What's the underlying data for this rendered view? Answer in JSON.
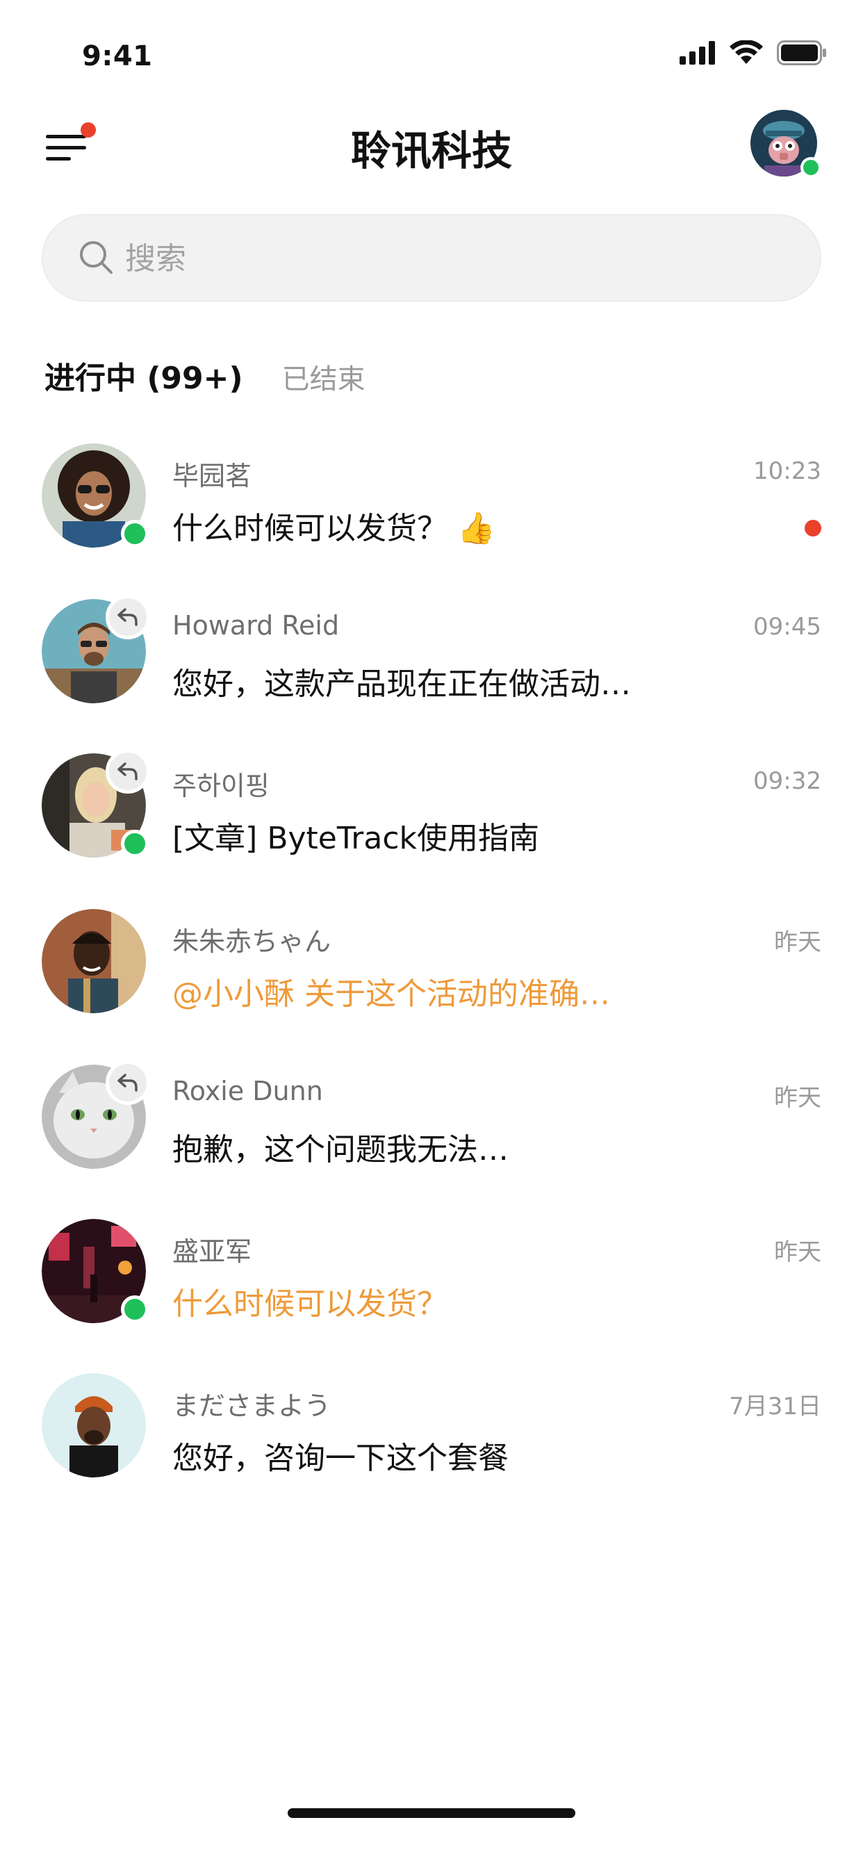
{
  "status_bar": {
    "time": "9:41"
  },
  "header": {
    "title": "聆讯科技"
  },
  "search": {
    "placeholder": "搜索"
  },
  "tabs": [
    {
      "label": "进行中 (99+)",
      "active": true
    },
    {
      "label": "已结束",
      "active": false
    }
  ],
  "colors": {
    "online": "#1fbf5a",
    "unread": "#e8412c",
    "highlight": "#ee9a3a"
  },
  "chats": [
    {
      "name": "毕园茗",
      "time": "10:23",
      "message": "什么时候可以发货？ 👍",
      "online": true,
      "unread": true,
      "replied": false,
      "highlight": false
    },
    {
      "name": "Howard Reid",
      "time": "09:45",
      "message": "您好，这款产品现在正在做活动…",
      "online": false,
      "unread": false,
      "replied": true,
      "highlight": false
    },
    {
      "name": "주하이핑",
      "time": "09:32",
      "message": "[文章] ByteTrack使用指南",
      "online": true,
      "unread": false,
      "replied": true,
      "highlight": false
    },
    {
      "name": "朱朱赤ちゃん",
      "time": "昨天",
      "message": "@小小酥 关于这个活动的准确…",
      "online": false,
      "unread": false,
      "replied": false,
      "highlight": true
    },
    {
      "name": "Roxie Dunn",
      "time": "昨天",
      "message": "抱歉，这个问题我无法…",
      "online": false,
      "unread": false,
      "replied": true,
      "highlight": false
    },
    {
      "name": "盛亚军",
      "time": "昨天",
      "message": "什么时候可以发货？",
      "online": true,
      "unread": false,
      "replied": false,
      "highlight": true
    },
    {
      "name": "まださまよう",
      "time": "7月31日",
      "message": "您好，咨询一下这个套餐",
      "online": false,
      "unread": false,
      "replied": false,
      "highlight": false
    }
  ]
}
